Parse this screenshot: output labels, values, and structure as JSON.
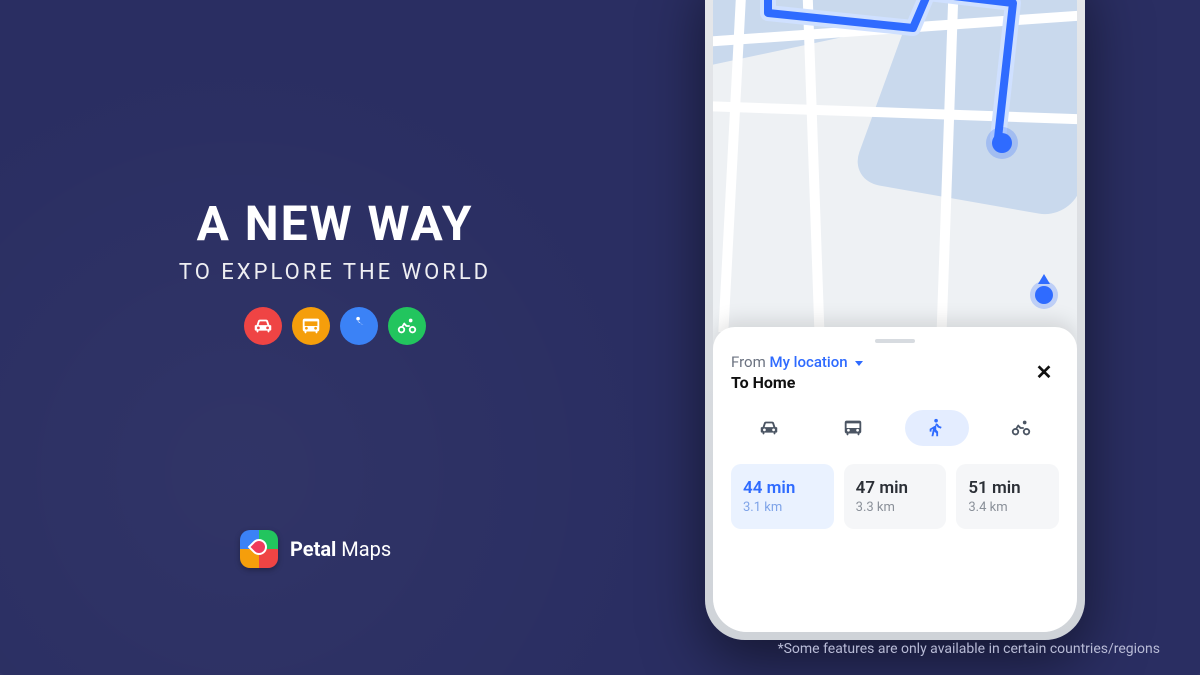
{
  "hero": {
    "title": "A NEW WAY",
    "subtitle": "TO EXPLORE THE WORLD"
  },
  "brand": {
    "name_bold": "Petal",
    "name_rest": " Maps"
  },
  "sheet": {
    "from_label": "From",
    "from_value": "My location",
    "to_label_prefix": "To ",
    "to_value": "Home"
  },
  "modes": [
    "car",
    "bus",
    "walk",
    "bike"
  ],
  "selected_mode": "walk",
  "routes": [
    {
      "time": "44 min",
      "dist": "3.1 km",
      "selected": true
    },
    {
      "time": "47 min",
      "dist": "3.3 km",
      "selected": false
    },
    {
      "time": "51 min",
      "dist": "3.4 km",
      "selected": false
    }
  ],
  "disclaimer": "*Some features are only available in certain countries/regions",
  "colors": {
    "bg": "#2a2e62",
    "accent": "#2f6bff",
    "car": "#ef4444",
    "bus": "#f59e0b",
    "walk": "#3b82f6",
    "bike": "#22c55e"
  }
}
